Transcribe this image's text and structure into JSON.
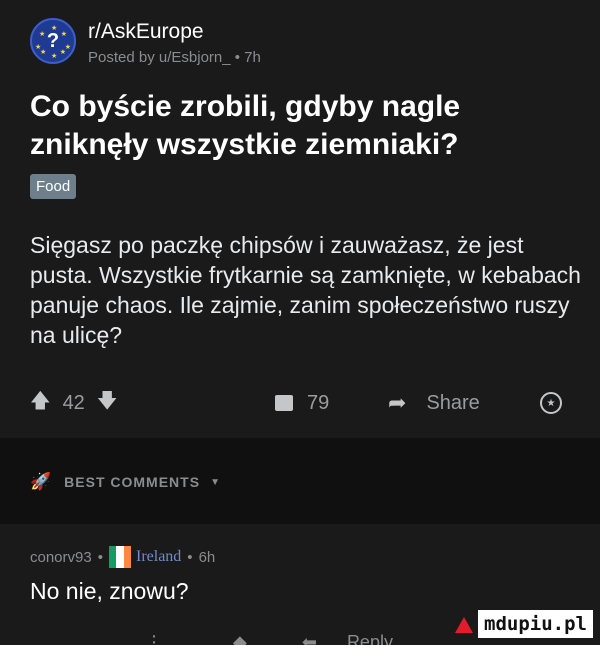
{
  "post": {
    "subreddit": "r/AskEurope",
    "posted_by": "Posted by u/Esbjorn_ • 7h",
    "title": "Co byście zrobili, gdyby nagle zniknęły wszystkie ziemniaki?",
    "flair": "Food",
    "body": "Sięgasz po paczkę chipsów i zauważasz, że jest pusta. Wszystkie frytkarnie są zamknięte, w kebabach panuje chaos. Ile zajmie, zanim społeczeństwo ruszy na ulicę?",
    "votes": "42",
    "comments": "79",
    "share_label": "Share"
  },
  "sort": {
    "label": "BEST COMMENTS"
  },
  "comment": {
    "author": "conorv93",
    "country": "Ireland",
    "age": "6h",
    "text": "No nie, znowu?",
    "reply_label": "Reply"
  },
  "watermark": {
    "text": "mdupiu.pl"
  },
  "colors": {
    "background": "#1a1a1b",
    "separator": "#101011",
    "flair": "#6e7f8c",
    "country_link": "#6f8ec9"
  },
  "icons": [
    "askeurope-avatar-icon",
    "upvote-icon",
    "downvote-icon",
    "comment-icon",
    "share-icon",
    "award-icon",
    "rocket-icon",
    "chevron-down-icon",
    "ireland-flag-icon",
    "more-icon",
    "reply-icon"
  ]
}
